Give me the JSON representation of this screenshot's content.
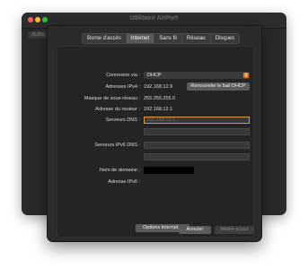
{
  "window": {
    "title": "Utilitaire AirPort",
    "side_button": "Autre"
  },
  "tabs": [
    {
      "label": "Borne d'accès",
      "active": false
    },
    {
      "label": "Internet",
      "active": true
    },
    {
      "label": "Sans fil",
      "active": false
    },
    {
      "label": "Réseau",
      "active": false
    },
    {
      "label": "Disques",
      "active": false
    }
  ],
  "form": {
    "connexion_label": "Connexion via :",
    "connexion_value": "DHCP",
    "ipv4_label": "Adresses IPv4 :",
    "ipv4_value": "192.168.12.9",
    "renew_button": "Renouveler le bail DHCP",
    "mask_label": "Masque de sous-réseau :",
    "mask_value": "255.255.255.0",
    "router_label": "Adresse du routeur :",
    "router_value": "192.168.12.1",
    "dns_label": "Serveurs DNS :",
    "dns_placeholder": "192.168.12.1",
    "dns6_label": "Serveurs IPv6 DNS :",
    "domain_label": "Nom de domaine :",
    "ipv6_label": "Adresse IPv6 :",
    "options_button": "Options Internet..."
  },
  "footer": {
    "cancel": "Annuler",
    "update": "Mettre à jour"
  },
  "colors": {
    "accent": "#e07a1f",
    "focus": "#d89a3a"
  }
}
